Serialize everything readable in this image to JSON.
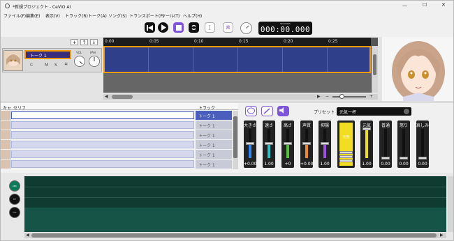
{
  "window": {
    "title": "*新規プロジェクト - CeVIO AI",
    "controls": {
      "minimize": "—",
      "maximize": "☐",
      "close": "✕"
    }
  },
  "menu": [
    "ファイル(F)",
    "編集(E)",
    "表示(V)",
    "トラック(R)",
    "トーク(A)",
    "ソング(S)",
    "トランスポート(P)",
    "ツール(T)",
    "ヘルプ(H)"
  ],
  "toolbar": {
    "timer_label": "SECONDS",
    "timer_value": "000:00.000",
    "buttons": [
      "skip-back",
      "play",
      "stop",
      "loop"
    ]
  },
  "track": {
    "name": "トーク 1",
    "small_buttons": [
      "C",
      "M",
      "S",
      "✲"
    ],
    "vol_label": "VOL",
    "pan_label": "PAN",
    "add_buttons": [
      "+",
      "↑",
      "↓"
    ]
  },
  "ruler": {
    "ticks": [
      "0:00",
      "0:05",
      "0:10",
      "0:15",
      "0:20",
      "0:25"
    ]
  },
  "table": {
    "col_kyara": "キャ",
    "col_serif": "セリフ",
    "col_track": "トラック",
    "rows": [
      {
        "track": "トーク 1",
        "selected": true
      },
      {
        "track": "トーク 1",
        "selected": false
      },
      {
        "track": "トーク 1",
        "selected": false
      },
      {
        "track": "トーク 1",
        "selected": false
      },
      {
        "track": "トーク 1",
        "selected": false
      },
      {
        "track": "トーク 1",
        "selected": false
      }
    ]
  },
  "preset": {
    "label": "プリセット",
    "value": "元気一杯"
  },
  "params": [
    {
      "name": "大きさ",
      "value": "+0.00",
      "color": "#2f86f2",
      "level": 0.5
    },
    {
      "name": "速さ",
      "value": "1.00",
      "color": "#22c2c8",
      "level": 0.5
    },
    {
      "name": "高さ",
      "value": "+0",
      "color": "#53c43a",
      "level": 0.5
    },
    {
      "name": "声質",
      "value": "+0.00",
      "color": "#e98a2c",
      "level": 0.5
    },
    {
      "name": "抑揚",
      "value": "1.00",
      "color": "#9b4fe3",
      "level": 0.5
    }
  ],
  "emotion_big": {
    "name": "元気",
    "color": "#f1dd22"
  },
  "emotions": [
    {
      "name": "元気",
      "value": "1.00",
      "color": "#f1dd22",
      "level": 1.0
    },
    {
      "name": "普通",
      "value": "0.00",
      "color": "#aaaaaa",
      "level": 0.0
    },
    {
      "name": "怒り",
      "value": "0.00",
      "color": "#aaaaaa",
      "level": 0.0
    },
    {
      "name": "哀しみ",
      "value": "0.00",
      "color": "#aaaaaa",
      "level": 0.0
    }
  ],
  "waveform": {
    "buttons": [
      "ABC",
      "PIT",
      "VOL"
    ]
  },
  "colors": {
    "accent_orange": "#f29a00",
    "lane_blue": "#2f3f8a",
    "selected_row": "#4a5fbd",
    "wave_bg": "#0f3b31"
  }
}
